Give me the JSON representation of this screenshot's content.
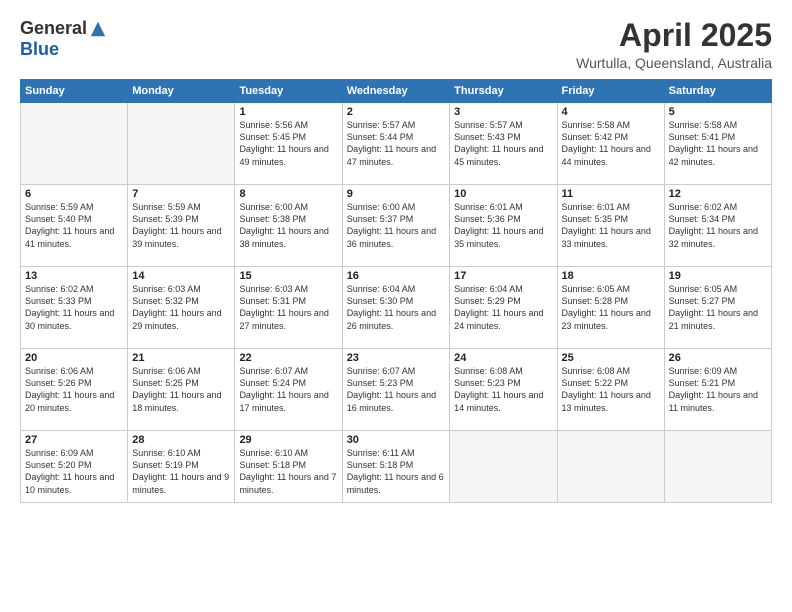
{
  "header": {
    "logo_general": "General",
    "logo_blue": "Blue",
    "month_title": "April 2025",
    "location": "Wurtulla, Queensland, Australia"
  },
  "days_of_week": [
    "Sunday",
    "Monday",
    "Tuesday",
    "Wednesday",
    "Thursday",
    "Friday",
    "Saturday"
  ],
  "weeks": [
    [
      {
        "day": "",
        "info": ""
      },
      {
        "day": "",
        "info": ""
      },
      {
        "day": "1",
        "info": "Sunrise: 5:56 AM\nSunset: 5:45 PM\nDaylight: 11 hours and 49 minutes."
      },
      {
        "day": "2",
        "info": "Sunrise: 5:57 AM\nSunset: 5:44 PM\nDaylight: 11 hours and 47 minutes."
      },
      {
        "day": "3",
        "info": "Sunrise: 5:57 AM\nSunset: 5:43 PM\nDaylight: 11 hours and 45 minutes."
      },
      {
        "day": "4",
        "info": "Sunrise: 5:58 AM\nSunset: 5:42 PM\nDaylight: 11 hours and 44 minutes."
      },
      {
        "day": "5",
        "info": "Sunrise: 5:58 AM\nSunset: 5:41 PM\nDaylight: 11 hours and 42 minutes."
      }
    ],
    [
      {
        "day": "6",
        "info": "Sunrise: 5:59 AM\nSunset: 5:40 PM\nDaylight: 11 hours and 41 minutes."
      },
      {
        "day": "7",
        "info": "Sunrise: 5:59 AM\nSunset: 5:39 PM\nDaylight: 11 hours and 39 minutes."
      },
      {
        "day": "8",
        "info": "Sunrise: 6:00 AM\nSunset: 5:38 PM\nDaylight: 11 hours and 38 minutes."
      },
      {
        "day": "9",
        "info": "Sunrise: 6:00 AM\nSunset: 5:37 PM\nDaylight: 11 hours and 36 minutes."
      },
      {
        "day": "10",
        "info": "Sunrise: 6:01 AM\nSunset: 5:36 PM\nDaylight: 11 hours and 35 minutes."
      },
      {
        "day": "11",
        "info": "Sunrise: 6:01 AM\nSunset: 5:35 PM\nDaylight: 11 hours and 33 minutes."
      },
      {
        "day": "12",
        "info": "Sunrise: 6:02 AM\nSunset: 5:34 PM\nDaylight: 11 hours and 32 minutes."
      }
    ],
    [
      {
        "day": "13",
        "info": "Sunrise: 6:02 AM\nSunset: 5:33 PM\nDaylight: 11 hours and 30 minutes."
      },
      {
        "day": "14",
        "info": "Sunrise: 6:03 AM\nSunset: 5:32 PM\nDaylight: 11 hours and 29 minutes."
      },
      {
        "day": "15",
        "info": "Sunrise: 6:03 AM\nSunset: 5:31 PM\nDaylight: 11 hours and 27 minutes."
      },
      {
        "day": "16",
        "info": "Sunrise: 6:04 AM\nSunset: 5:30 PM\nDaylight: 11 hours and 26 minutes."
      },
      {
        "day": "17",
        "info": "Sunrise: 6:04 AM\nSunset: 5:29 PM\nDaylight: 11 hours and 24 minutes."
      },
      {
        "day": "18",
        "info": "Sunrise: 6:05 AM\nSunset: 5:28 PM\nDaylight: 11 hours and 23 minutes."
      },
      {
        "day": "19",
        "info": "Sunrise: 6:05 AM\nSunset: 5:27 PM\nDaylight: 11 hours and 21 minutes."
      }
    ],
    [
      {
        "day": "20",
        "info": "Sunrise: 6:06 AM\nSunset: 5:26 PM\nDaylight: 11 hours and 20 minutes."
      },
      {
        "day": "21",
        "info": "Sunrise: 6:06 AM\nSunset: 5:25 PM\nDaylight: 11 hours and 18 minutes."
      },
      {
        "day": "22",
        "info": "Sunrise: 6:07 AM\nSunset: 5:24 PM\nDaylight: 11 hours and 17 minutes."
      },
      {
        "day": "23",
        "info": "Sunrise: 6:07 AM\nSunset: 5:23 PM\nDaylight: 11 hours and 16 minutes."
      },
      {
        "day": "24",
        "info": "Sunrise: 6:08 AM\nSunset: 5:23 PM\nDaylight: 11 hours and 14 minutes."
      },
      {
        "day": "25",
        "info": "Sunrise: 6:08 AM\nSunset: 5:22 PM\nDaylight: 11 hours and 13 minutes."
      },
      {
        "day": "26",
        "info": "Sunrise: 6:09 AM\nSunset: 5:21 PM\nDaylight: 11 hours and 11 minutes."
      }
    ],
    [
      {
        "day": "27",
        "info": "Sunrise: 6:09 AM\nSunset: 5:20 PM\nDaylight: 11 hours and 10 minutes."
      },
      {
        "day": "28",
        "info": "Sunrise: 6:10 AM\nSunset: 5:19 PM\nDaylight: 11 hours and 9 minutes."
      },
      {
        "day": "29",
        "info": "Sunrise: 6:10 AM\nSunset: 5:18 PM\nDaylight: 11 hours and 7 minutes."
      },
      {
        "day": "30",
        "info": "Sunrise: 6:11 AM\nSunset: 5:18 PM\nDaylight: 11 hours and 6 minutes."
      },
      {
        "day": "",
        "info": ""
      },
      {
        "day": "",
        "info": ""
      },
      {
        "day": "",
        "info": ""
      }
    ]
  ]
}
